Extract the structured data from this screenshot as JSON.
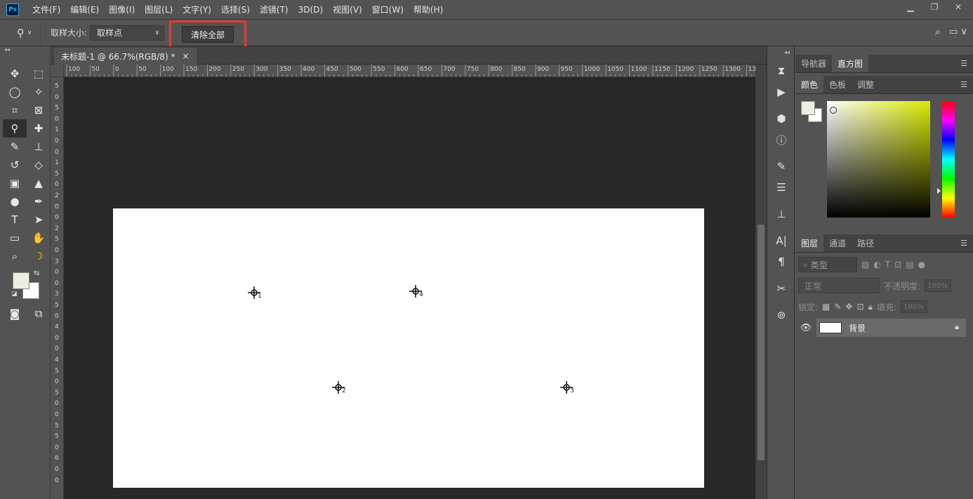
{
  "app": {
    "logo": "Ps"
  },
  "menu": [
    "文件(F)",
    "编辑(E)",
    "图像(I)",
    "图层(L)",
    "文字(Y)",
    "选择(S)",
    "滤镜(T)",
    "3D(D)",
    "视图(V)",
    "窗口(W)",
    "帮助(H)"
  ],
  "options": {
    "sample_size_label": "取样大小:",
    "sample_size_value": "取样点",
    "clear_all_label": "清除全部"
  },
  "document": {
    "tab_title": "未标题-1 @ 66.7%(RGB/8) *",
    "close_glyph": "×",
    "ruler_top_labels": [
      "100",
      "50",
      "0",
      "50",
      "100",
      "150",
      "200",
      "250",
      "300",
      "350",
      "400",
      "450",
      "500",
      "550",
      "600",
      "650",
      "700",
      "750",
      "800",
      "850",
      "900",
      "950",
      "1000",
      "1050",
      "1100",
      "1150",
      "1200",
      "1250",
      "1300",
      "13"
    ],
    "ruler_left_labels": [
      "5",
      "0",
      "5",
      "0",
      "1",
      "0",
      "0",
      "1",
      "5",
      "0",
      "2",
      "0",
      "0",
      "2",
      "5",
      "0",
      "3",
      "0",
      "0",
      "3",
      "5",
      "0",
      "4",
      "0",
      "0",
      "4",
      "5",
      "0",
      "5",
      "0",
      "0",
      "5",
      "5",
      "0",
      "6",
      "0",
      "0"
    ],
    "samplers": [
      "1",
      "2",
      "3",
      "4"
    ]
  },
  "panels": {
    "top_tabs": [
      "导航器",
      "直方图"
    ],
    "color_tabs": [
      "颜色",
      "色板",
      "调整"
    ],
    "layer_tabs": [
      "图层",
      "通道",
      "路径"
    ],
    "filter_placeholder": "类型",
    "blend_mode": "正常",
    "opacity_label": "不透明度:",
    "opacity_value": "100%",
    "lock_label": "锁定:",
    "fill_label": "填充:",
    "fill_value": "100%",
    "layer_name": "背景"
  },
  "colors": {
    "foreground": "#edeee0",
    "background": "#ffffff",
    "highlight_border": "#e53935",
    "hue_pick": "#d9ea00"
  }
}
